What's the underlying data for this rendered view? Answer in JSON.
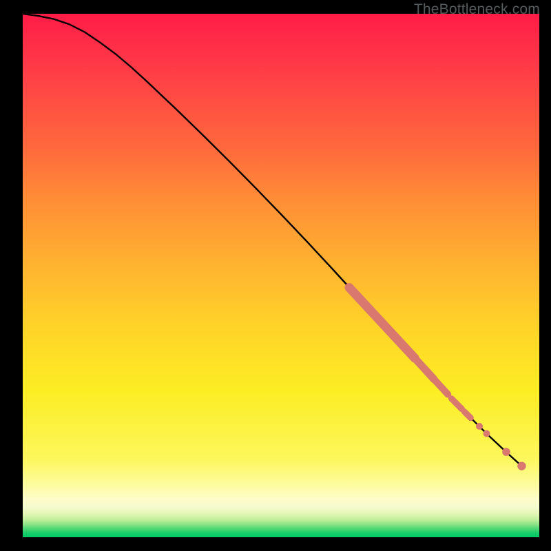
{
  "watermark": "TheBottleneck.com",
  "chart_data": {
    "type": "line",
    "title": "",
    "xlabel": "",
    "ylabel": "",
    "xlim": [
      0,
      100
    ],
    "ylim": [
      0,
      100
    ],
    "grid": false,
    "curve": {
      "name": "main-curve",
      "color": "#000000",
      "points": [
        {
          "x": 0.0,
          "y": 100.0
        },
        {
          "x": 3.0,
          "y": 99.6
        },
        {
          "x": 6.0,
          "y": 99.0
        },
        {
          "x": 9.0,
          "y": 98.0
        },
        {
          "x": 12.0,
          "y": 96.5
        },
        {
          "x": 15.0,
          "y": 94.5
        },
        {
          "x": 18.0,
          "y": 92.3
        },
        {
          "x": 21.0,
          "y": 89.8
        },
        {
          "x": 24.0,
          "y": 87.1
        },
        {
          "x": 27.0,
          "y": 84.3
        },
        {
          "x": 30.0,
          "y": 81.5
        },
        {
          "x": 35.0,
          "y": 76.7
        },
        {
          "x": 40.0,
          "y": 71.8
        },
        {
          "x": 45.0,
          "y": 66.8
        },
        {
          "x": 50.0,
          "y": 61.7
        },
        {
          "x": 55.0,
          "y": 56.5
        },
        {
          "x": 60.0,
          "y": 51.2
        },
        {
          "x": 65.0,
          "y": 45.8
        },
        {
          "x": 70.0,
          "y": 40.4
        },
        {
          "x": 75.0,
          "y": 35.0
        },
        {
          "x": 80.0,
          "y": 29.7
        },
        {
          "x": 85.0,
          "y": 24.5
        },
        {
          "x": 90.0,
          "y": 19.6
        },
        {
          "x": 94.0,
          "y": 15.9
        },
        {
          "x": 96.7,
          "y": 13.5
        }
      ]
    },
    "marker_segments": [
      {
        "x0": 63.2,
        "y0": 47.7,
        "x1": 75.9,
        "y1": 34.2,
        "width": 13
      },
      {
        "x0": 75.9,
        "y0": 34.2,
        "x1": 79.6,
        "y1": 30.2,
        "width": 11
      },
      {
        "x0": 79.6,
        "y0": 30.2,
        "x1": 82.3,
        "y1": 27.3,
        "width": 10
      },
      {
        "x0": 83.0,
        "y0": 26.5,
        "x1": 85.0,
        "y1": 24.5,
        "width": 9
      },
      {
        "x0": 85.5,
        "y0": 24.0,
        "x1": 86.7,
        "y1": 22.8,
        "width": 9
      }
    ],
    "marker_dots": [
      {
        "x": 88.4,
        "y": 21.2,
        "r": 5.0
      },
      {
        "x": 89.8,
        "y": 19.8,
        "r": 5.0
      },
      {
        "x": 93.6,
        "y": 16.3,
        "r": 5.8
      },
      {
        "x": 96.6,
        "y": 13.6,
        "r": 6.2
      }
    ],
    "marker_color": "#d8786f"
  }
}
